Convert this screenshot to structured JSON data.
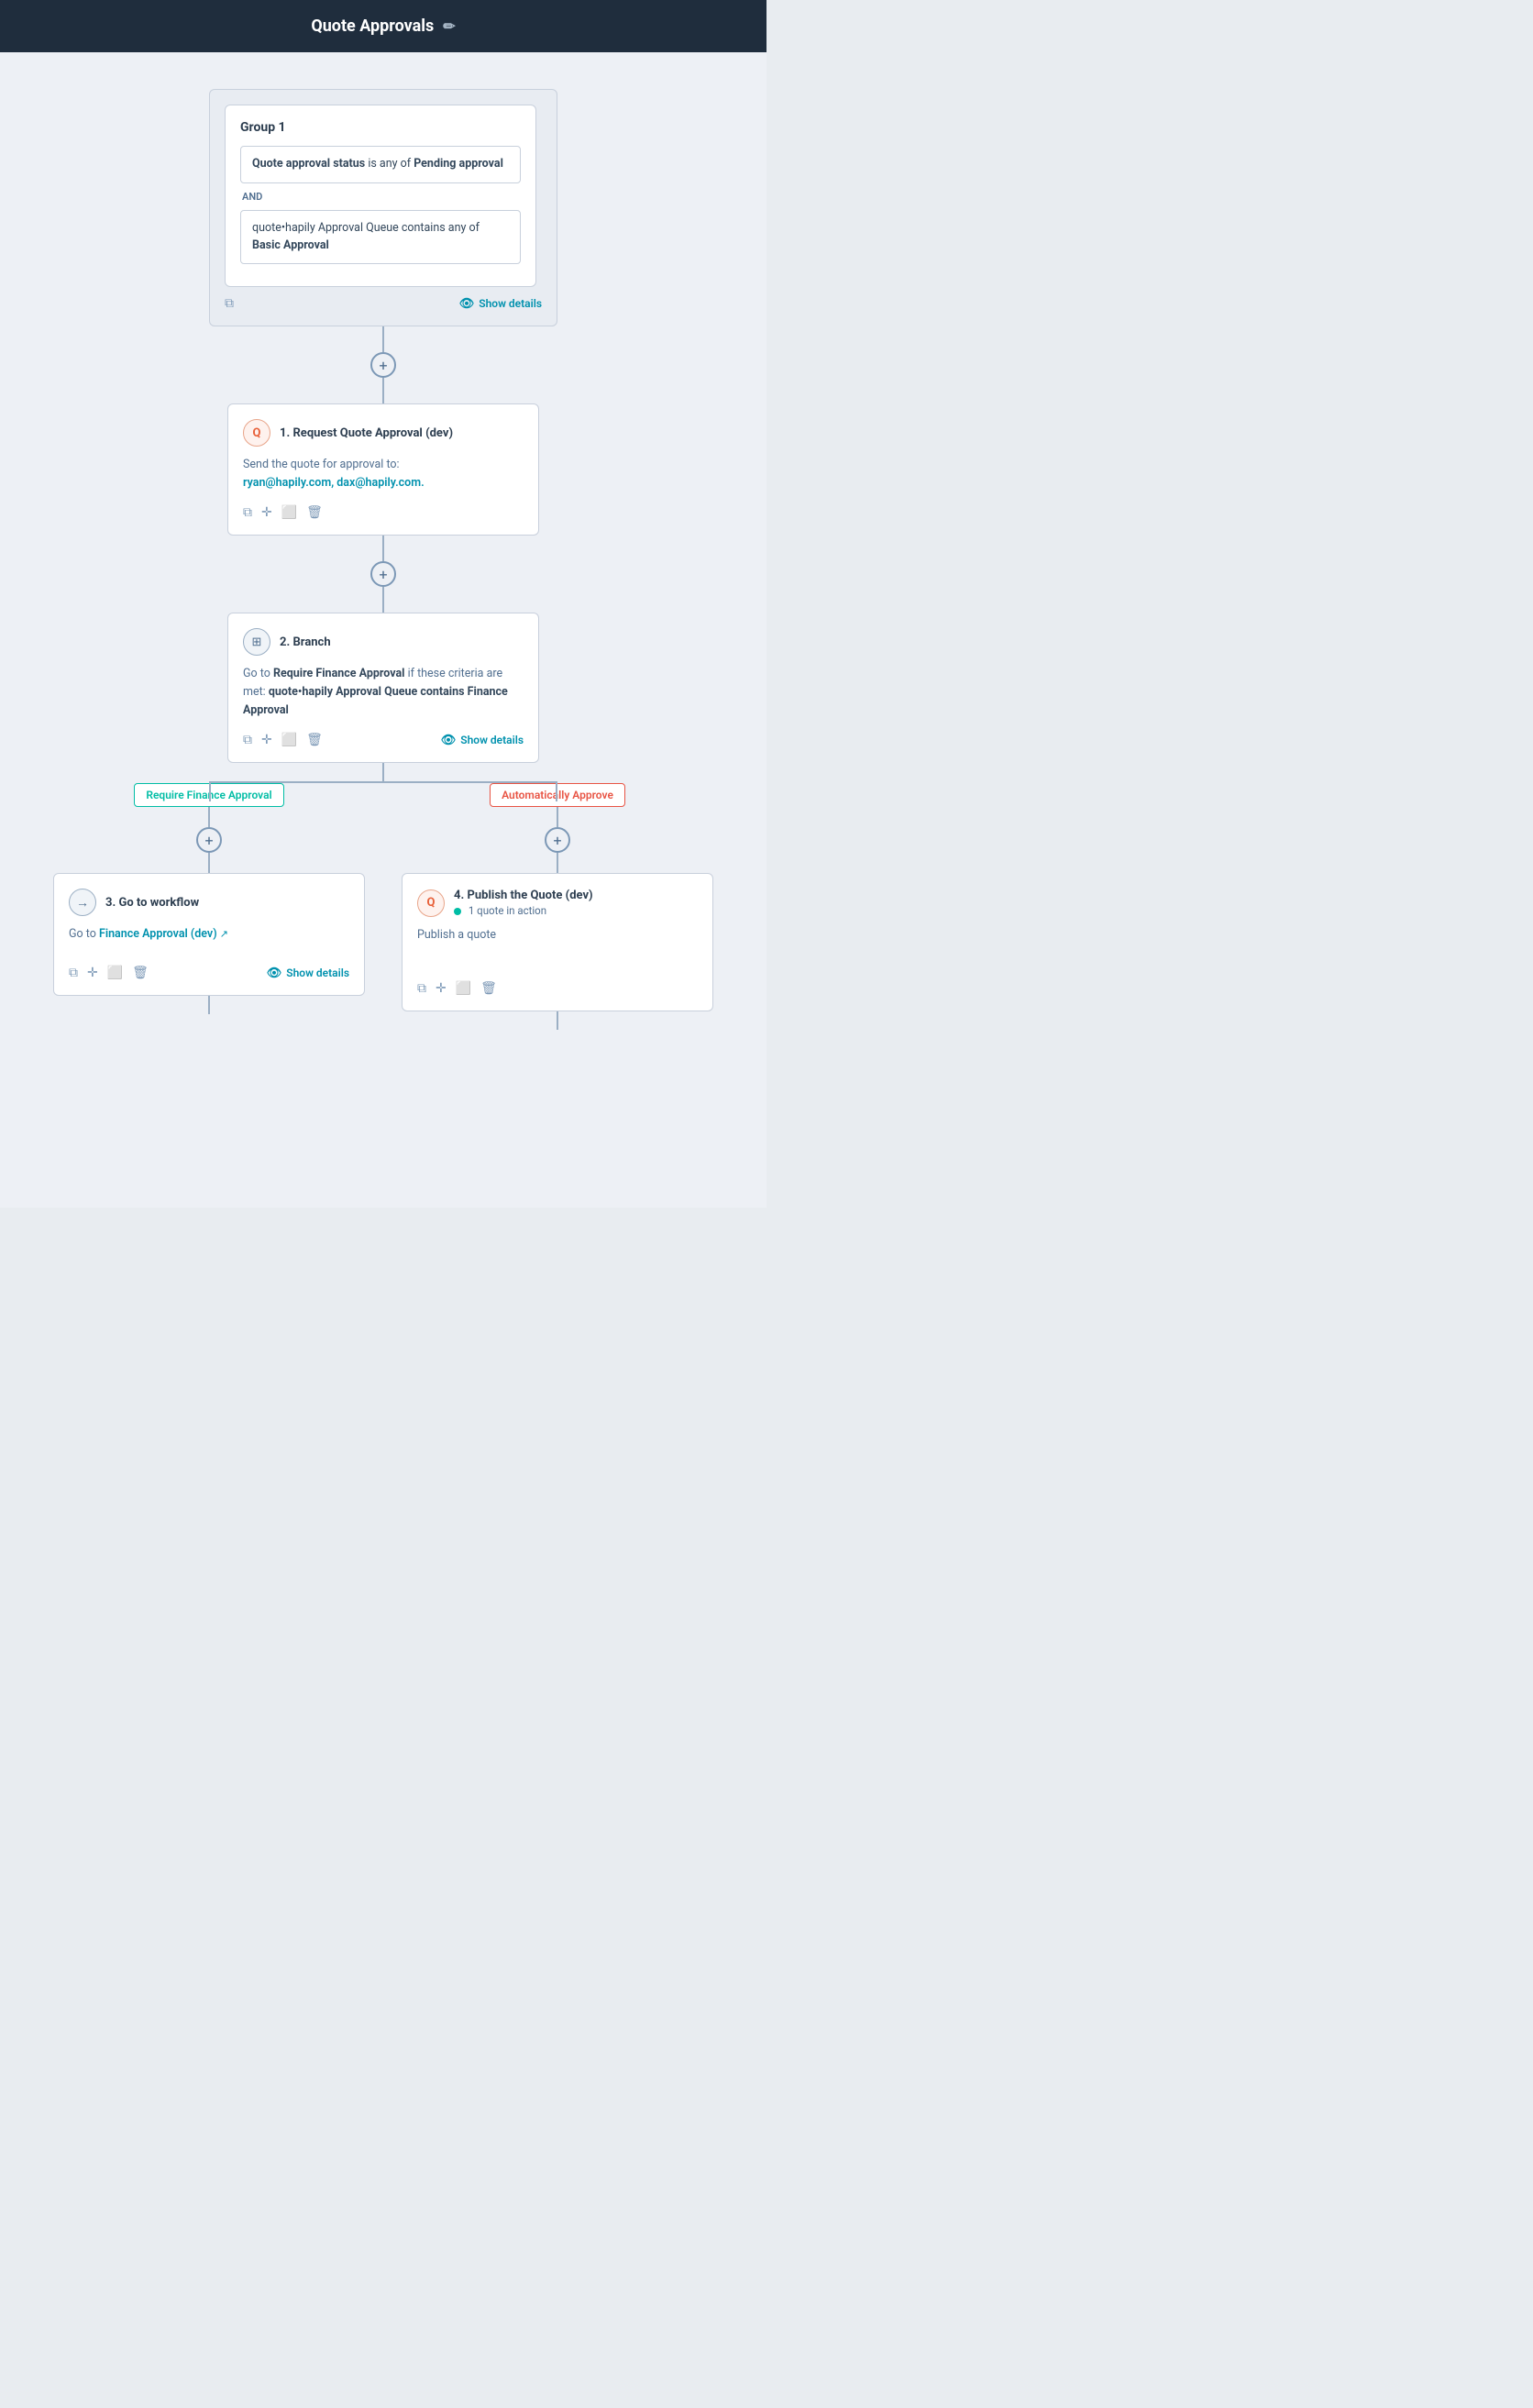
{
  "header": {
    "title": "Quote Approvals",
    "edit_icon": "✏"
  },
  "trigger": {
    "group_label": "Group 1",
    "condition1_text_plain": " is any of ",
    "condition1_bold1": "Quote approval status",
    "condition1_bold2": "Pending approval",
    "and_label": "AND",
    "condition2_text": "quote•hapily Approval Queue contains any of ",
    "condition2_bold": "Basic Approval",
    "show_details": "Show details"
  },
  "step1": {
    "number": "1.",
    "title": "Request Quote Approval (dev)",
    "body_plain": "Send the quote for approval to:",
    "body_highlight": "ryan@hapily.com, dax@hapily.com."
  },
  "step2": {
    "number": "2.",
    "title": "Branch",
    "body_plain": "Go to ",
    "body_bold1": "Require Finance Approval",
    "body_mid": " if these criteria are met: ",
    "body_bold2": "quote•hapily Approval Queue contains Finance Approval",
    "show_details": "Show details"
  },
  "branch_labels": {
    "left": "Require Finance Approval",
    "right": "Automatically Approve"
  },
  "step3": {
    "number": "3.",
    "title": "Go to workflow",
    "body_plain": "Go to ",
    "body_link": "Finance Approval (dev)",
    "show_details": "Show details"
  },
  "step4": {
    "number": "4.",
    "title": "Publish the Quote (dev)",
    "status_text": "1 quote in action",
    "body_plain": "Publish a quote"
  },
  "icons": {
    "copy": "⧉",
    "move": "✛",
    "clone": "⬜",
    "trash": "🗑",
    "eye": "👁",
    "edit": "✏",
    "external": "↗"
  }
}
